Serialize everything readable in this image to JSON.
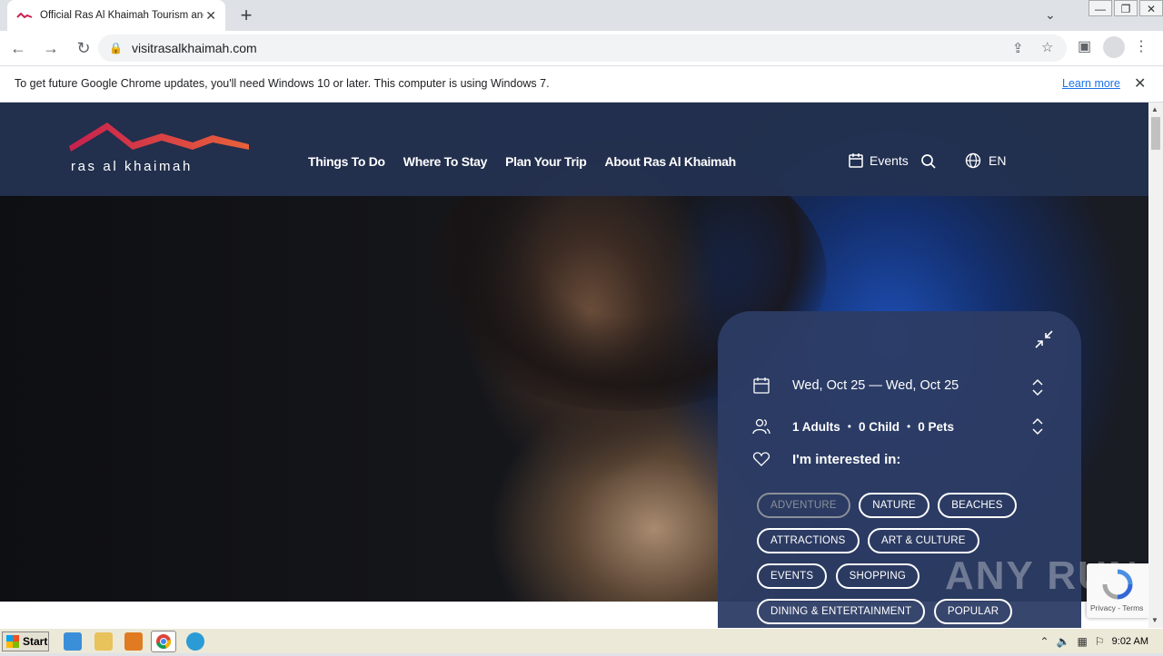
{
  "browser": {
    "tab_title": "Official Ras Al Khaimah Tourism and V",
    "tab_close": "✕",
    "new_tab": "+",
    "url": "visitrasalkhaimah.com",
    "window_controls": [
      "—",
      "❐",
      "✕"
    ]
  },
  "infobar": {
    "message": "To get future Google Chrome updates, you'll need Windows 10 or later. This computer is using Windows 7.",
    "learn_more": "Learn more",
    "close": "✕"
  },
  "site": {
    "logo_text": "ras al khaimah",
    "logo_colors": [
      "#c8214e",
      "#e8613a"
    ],
    "menu": [
      "Things To Do",
      "Where To Stay",
      "Plan Your Trip",
      "About Ras Al Khaimah"
    ],
    "events_label": "Events",
    "language": "EN"
  },
  "search_panel": {
    "dates": "Wed, Oct 25 — Wed, Oct 25",
    "guests": {
      "adults": "1 Adults",
      "child": "0 Child",
      "pets": "0 Pets",
      "separator": "•"
    },
    "interest_label": "I'm interested in:",
    "tags": [
      {
        "label": "ADVENTURE",
        "state": "disabled"
      },
      {
        "label": "NATURE",
        "state": "active"
      },
      {
        "label": "BEACHES",
        "state": "active"
      },
      {
        "label": "ATTRACTIONS",
        "state": "active"
      },
      {
        "label": "ART & CULTURE",
        "state": "active"
      },
      {
        "label": "EVENTS",
        "state": "active"
      },
      {
        "label": "SHOPPING",
        "state": "active"
      },
      {
        "label": "DINING & ENTERTAINMENT",
        "state": "active"
      },
      {
        "label": "POPULAR",
        "state": "active"
      }
    ]
  },
  "recaptcha": {
    "terms": "Privacy - Terms"
  },
  "watermark": "ANY RUN",
  "taskbar": {
    "start": "Start",
    "clock": "9:02 AM"
  }
}
